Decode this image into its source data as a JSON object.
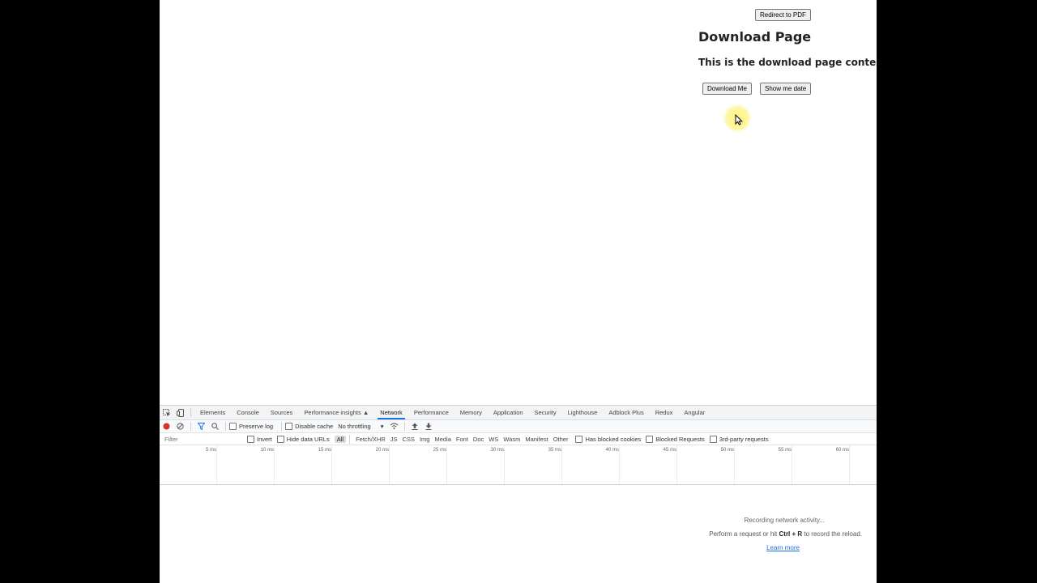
{
  "page": {
    "redirect_button": "Redirect to PDF",
    "title": "Download Page",
    "subtitle": "This is the download page content.",
    "download_button": "Download Me",
    "show_date_button": "Show me date"
  },
  "devtools": {
    "tabs": [
      "Elements",
      "Console",
      "Sources",
      "Performance insights",
      "Network",
      "Performance",
      "Memory",
      "Application",
      "Security",
      "Lighthouse",
      "Adblock Plus",
      "Redux",
      "Angular"
    ],
    "active_tab": "Network",
    "toolbar": {
      "preserve_log": "Preserve log",
      "disable_cache": "Disable cache",
      "throttling": "No throttling"
    },
    "filter": {
      "placeholder": "Filter",
      "invert": "Invert",
      "hide_data_urls": "Hide data URLs",
      "types": [
        "All",
        "Fetch/XHR",
        "JS",
        "CSS",
        "Img",
        "Media",
        "Font",
        "Doc",
        "WS",
        "Wasm",
        "Manifest",
        "Other"
      ],
      "active_type": "All",
      "has_blocked_cookies": "Has blocked cookies",
      "blocked_requests": "Blocked Requests",
      "third_party": "3rd-party requests"
    },
    "timeline_ticks": [
      "5 ms",
      "10 ms",
      "15 ms",
      "20 ms",
      "25 ms",
      "30 ms",
      "35 ms",
      "40 ms",
      "45 ms",
      "50 ms",
      "55 ms",
      "60 ms"
    ],
    "empty_state": {
      "line1": "Recording network activity...",
      "line2_prefix": "Perform a request or hit ",
      "line2_shortcut": "Ctrl + R",
      "line2_suffix": " to record the reload.",
      "learn_more": "Learn more"
    },
    "colors": {
      "record": "#d93025",
      "active_accent": "#1a73e8"
    }
  }
}
